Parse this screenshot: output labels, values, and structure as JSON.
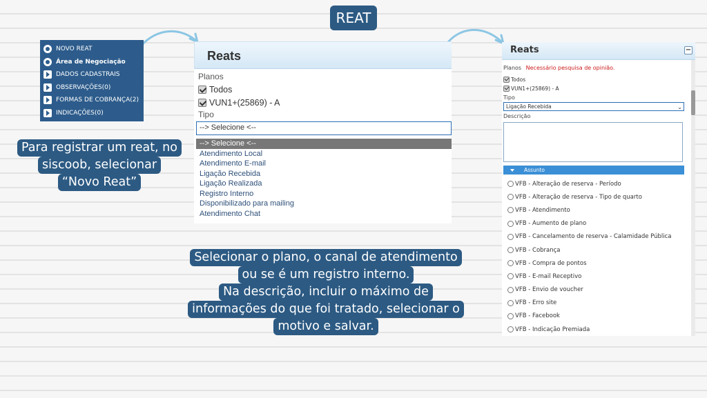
{
  "title": "REAT",
  "menu": {
    "items": [
      {
        "label": "NOVO REAT",
        "icon": "circle-arrow-icon"
      },
      {
        "label": "Área de Negociação",
        "icon": "circle-icon"
      },
      {
        "label": "DADOS CADASTRAIS",
        "icon": "arrow-right-icon"
      },
      {
        "label": "OBSERVAÇÕES(0)",
        "icon": "arrow-right-icon"
      },
      {
        "label": "FORMAS DE COBRANÇA(2)",
        "icon": "arrow-right-icon"
      },
      {
        "label": "INDICAÇÕES(0)",
        "icon": "arrow-right-icon"
      }
    ]
  },
  "callout_left": {
    "lines": [
      "Para registrar um reat, no",
      "siscoob, selecionar",
      "“Novo Reat”"
    ]
  },
  "callout_center": {
    "lines": [
      "Selecionar o plano, o canal de atendimento",
      "ou se é um registro interno.",
      "Na descrição, incluir o máximo de",
      "informações do que foi tratado, selecionar o",
      "motivo e salvar."
    ]
  },
  "mid_panel": {
    "title": "Reats",
    "planos_label": "Planos",
    "checkboxes": [
      "Todos",
      "VUN1+(25869) - A"
    ],
    "tipo_label": "Tipo",
    "select_value": "--> Selecione <--",
    "options": [
      "--> Selecione <--",
      "Atendimento Local",
      "Atendimento E-mail",
      "Ligação Recebida",
      "Ligação Realizada",
      "Registro Interno",
      "Disponibilizado para mailing",
      "Atendimento Chat"
    ]
  },
  "right_panel": {
    "title": "Reats",
    "collapse": "−",
    "planos_label": "Planos",
    "required_note": "Necessário pesquisa de opinião.",
    "checkboxes": [
      "Todos",
      "VUN1+(25869) - A"
    ],
    "tipo_label": "Tipo",
    "tipo_value": "Ligação Recebida",
    "descricao_label": "Descrição",
    "assunto_label": "Assunto",
    "assuntos": [
      "VFB - Alteração de reserva - Período",
      "VFB - Alteração de reserva - Tipo de quarto",
      "VFB - Atendimento",
      "VFB - Aumento de plano",
      "VFB - Cancelamento de reserva - Calamidade Pública",
      "VFB - Cobrança",
      "VFB - Compra de pontos",
      "VFB - E-mail Receptivo",
      "VFB - Envio de voucher",
      "VFB - Erro site",
      "VFB - Facebook",
      "VFB - Indicação Premiada"
    ]
  },
  "colors": {
    "accent": "#2c5a83",
    "arrow": "#8cc6e4",
    "required": "#cc1a1a"
  }
}
